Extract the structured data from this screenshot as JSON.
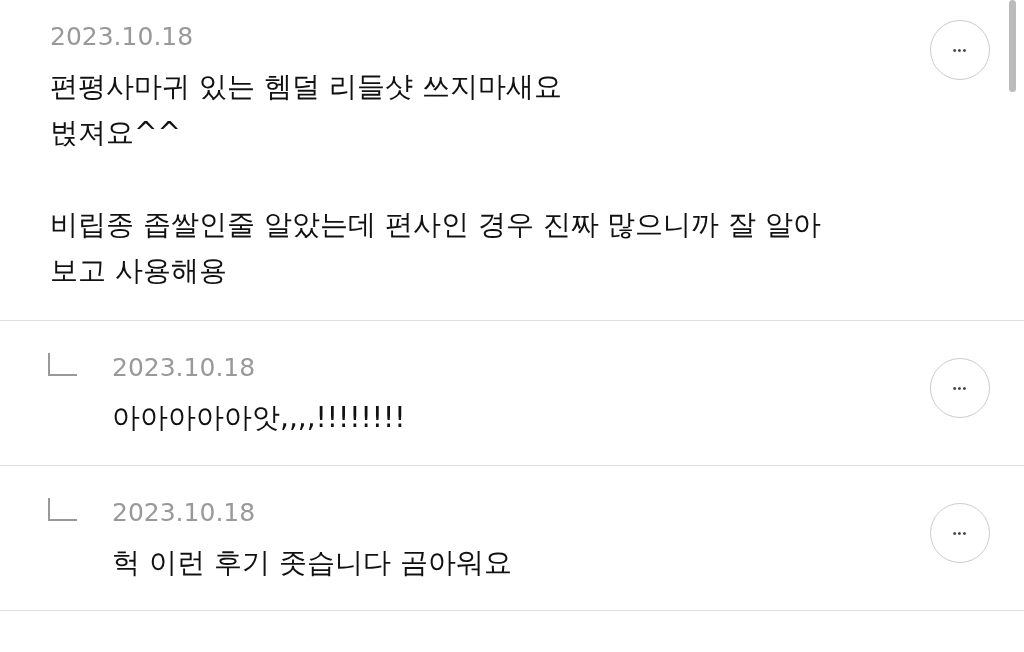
{
  "comments": [
    {
      "kind": "comment",
      "date": "2023.10.18",
      "paragraphs": [
        "편평사마귀 있는 헴덜 리들샷 쓰지마새요\n벉져요^^",
        "비립종 좁쌀인줄 알았는데 편사인 경우 진짜 많으니까 잘 알아\n보고 사용해용"
      ],
      "more": "•••"
    },
    {
      "kind": "reply",
      "date": "2023.10.18",
      "paragraphs": [
        "아아아아아앗,,,,!!!!!!!!"
      ],
      "more": "•••"
    },
    {
      "kind": "reply",
      "date": "2023.10.18",
      "paragraphs": [
        "헉 이런 후기 좃습니다 곰아워요"
      ],
      "more": "•••"
    }
  ]
}
